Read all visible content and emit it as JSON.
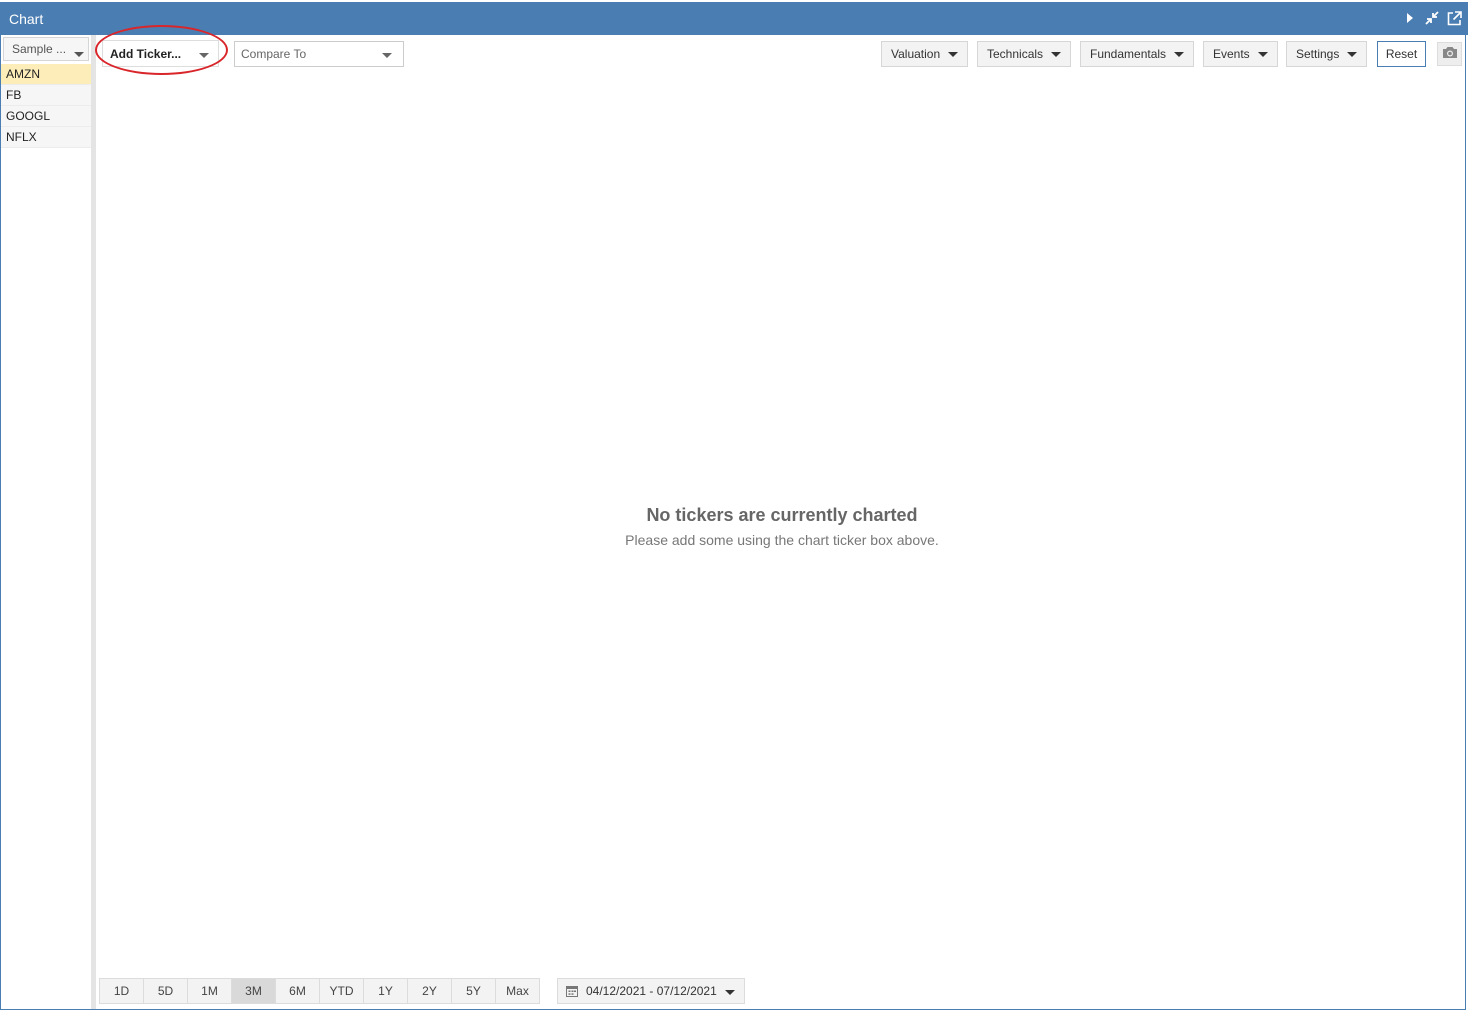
{
  "window": {
    "title": "Chart"
  },
  "sidebar": {
    "watchlist_label": "Sample ...",
    "tickers": [
      {
        "symbol": "AMZN",
        "active": true
      },
      {
        "symbol": "FB",
        "active": false
      },
      {
        "symbol": "GOOGL",
        "active": false
      },
      {
        "symbol": "NFLX",
        "active": false
      }
    ]
  },
  "toolbar": {
    "add_ticker_label": "Add Ticker...",
    "compare_to_placeholder": "Compare To",
    "menus": [
      {
        "label": "Valuation"
      },
      {
        "label": "Technicals"
      },
      {
        "label": "Fundamentals"
      },
      {
        "label": "Events"
      },
      {
        "label": "Settings"
      }
    ],
    "reset_label": "Reset",
    "camera_icon": "camera-icon"
  },
  "empty_state": {
    "title": "No tickers are currently charted",
    "subtitle": "Please add some using the chart ticker box above."
  },
  "range": {
    "buttons": [
      "1D",
      "5D",
      "1M",
      "3M",
      "6M",
      "YTD",
      "1Y",
      "2Y",
      "5Y",
      "Max"
    ],
    "selected": "3M",
    "date_range": "04/12/2021 - 07/12/2021"
  },
  "colors": {
    "title_bar": "#4a7db1",
    "active_ticker": "#fdeeb9",
    "highlight": "#d9262b"
  }
}
